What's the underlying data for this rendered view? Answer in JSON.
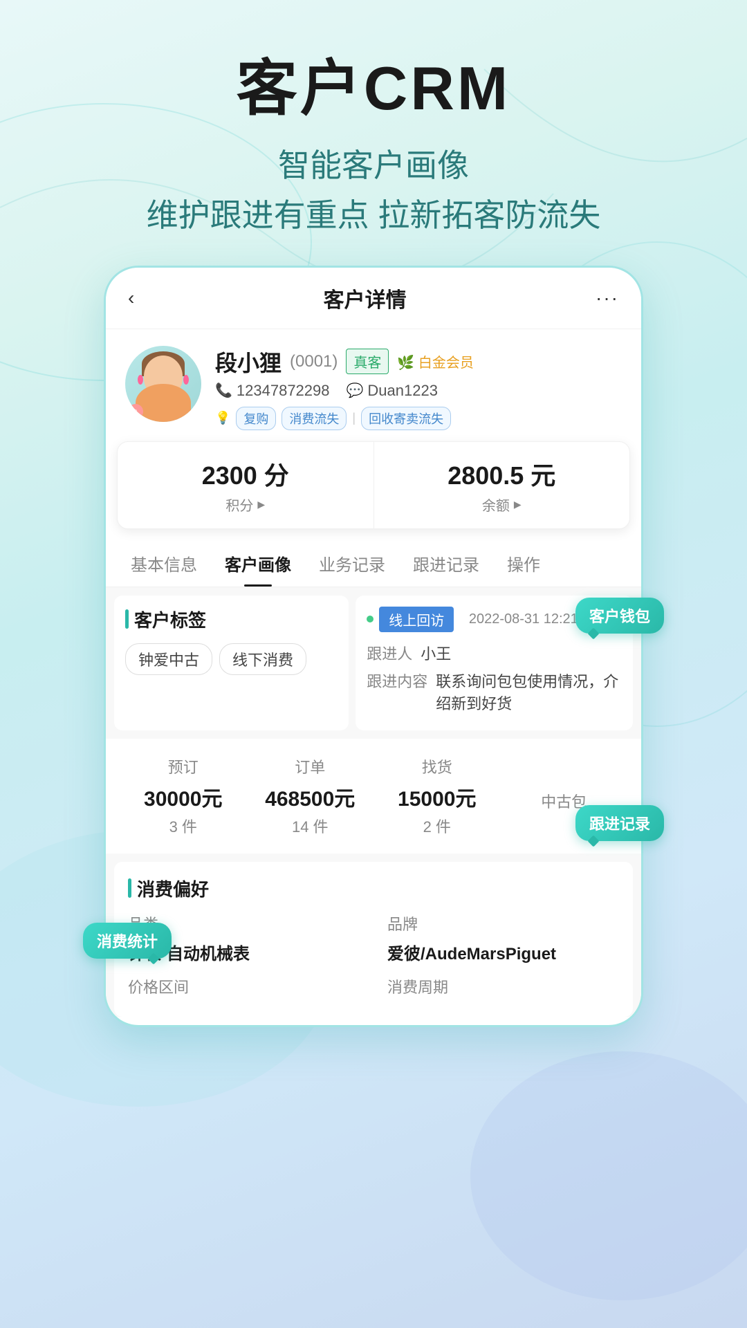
{
  "header": {
    "main_title": "客户CRM",
    "subtitle1": "智能客户画像",
    "subtitle2": "维护跟进有重点  拉新拓客防流失"
  },
  "nav": {
    "back_label": "‹",
    "title": "客户详情",
    "more_label": "···"
  },
  "customer": {
    "name": "段小狸",
    "id": "(0001)",
    "tag_zhike": "真客",
    "tag_member": "🌿 白金会员",
    "phone": "12347872298",
    "wechat": "Duan1223",
    "labels": [
      "复购",
      "消费流失",
      "回收寄卖流失"
    ]
  },
  "wallet": {
    "points_amount": "2300 分",
    "points_label": "积分",
    "balance_amount": "2800.5 元",
    "balance_label": "余额",
    "float_label": "客户钱包"
  },
  "tabs": [
    {
      "label": "基本信息",
      "active": false
    },
    {
      "label": "客户画像",
      "active": true
    },
    {
      "label": "业务记录",
      "active": false
    },
    {
      "label": "跟进记录",
      "active": false
    },
    {
      "label": "操作",
      "active": false
    }
  ],
  "customer_tags": {
    "section_title": "客户标签",
    "tags": [
      "钟爱中古",
      "线下消费"
    ]
  },
  "followup": {
    "float_label": "跟进记录",
    "tag_type": "线上回访",
    "date": "2022-08-31  12:21:00",
    "person_label": "跟进人",
    "person_value": "小王",
    "content_label": "跟进内容",
    "content_value": "联系询问包包使用情况，介绍新到好货"
  },
  "stats": {
    "float_label": "消费统计",
    "items": [
      {
        "label": "预订",
        "amount": "30000元",
        "count": "3 件"
      },
      {
        "label": "订单",
        "amount": "468500元",
        "count": "14 件"
      },
      {
        "label": "找货",
        "amount": "15000元",
        "count": "2 件"
      }
    ],
    "suffix_text": "中古包"
  },
  "preference": {
    "section_title": "消费偏好",
    "category_label": "品类",
    "category_value": "钟表-自动机械表",
    "brand_label": "品牌",
    "brand_value": "爱彼/AudeMarsPiguet",
    "price_label": "价格区间",
    "cycle_label": "消费周期"
  },
  "colors": {
    "teal": "#2ab8a8",
    "light_teal": "#3dd8c8",
    "bg_gradient_start": "#e8f8f8",
    "bg_gradient_end": "#c8d8f0",
    "text_dark": "#1a1a1a",
    "text_gray": "#888888"
  }
}
